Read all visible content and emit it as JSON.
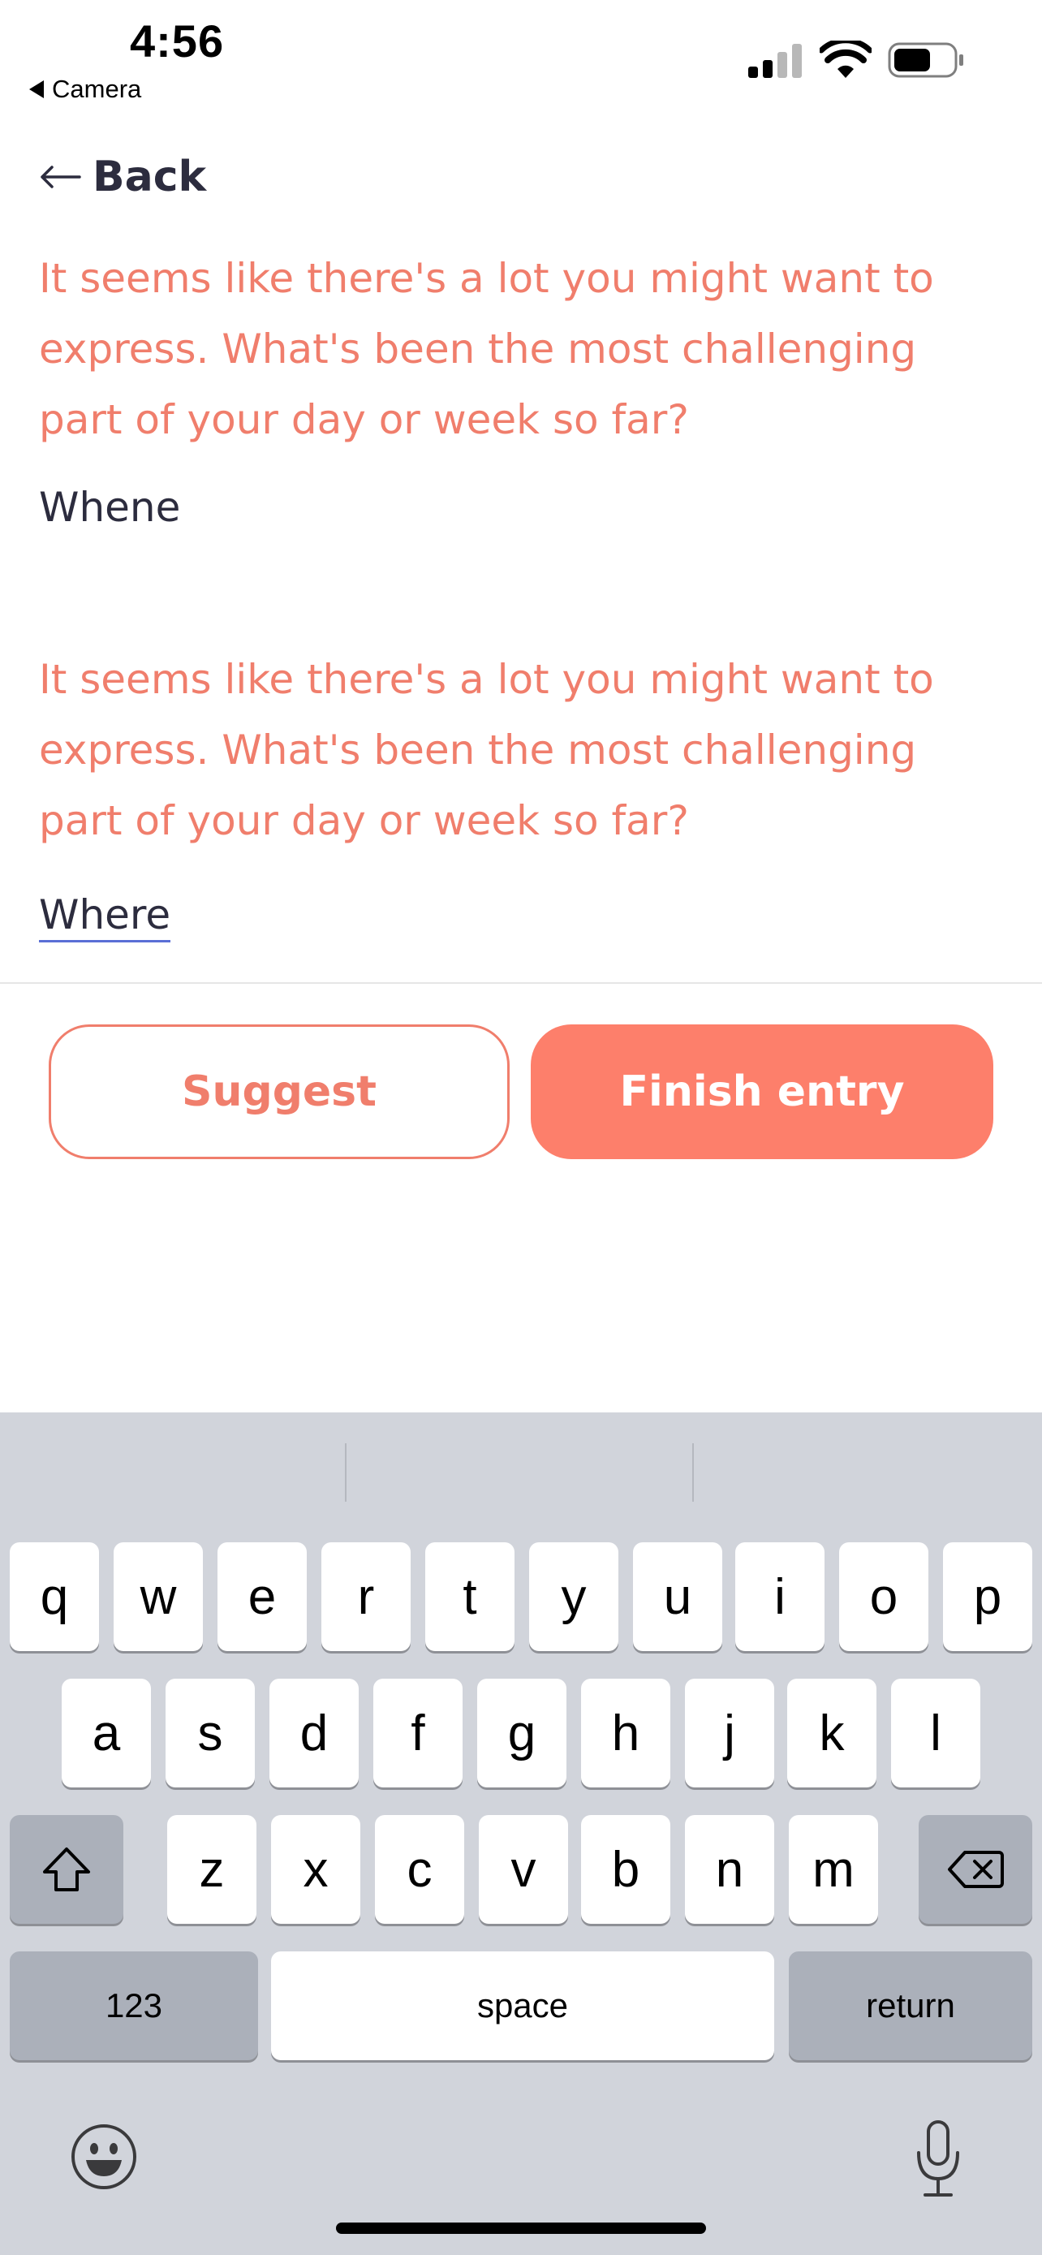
{
  "status_bar": {
    "time": "4:56",
    "back_app_label": "Camera"
  },
  "nav": {
    "back_label": "Back"
  },
  "conversation": [
    {
      "prompt": "It seems like there's a lot you might want to express. What's been the most challenging part of your day or week so far?",
      "answer": "Whene"
    },
    {
      "prompt": "It seems like there's a lot you might want to express. What's been the most challenging part of your day or week so far?",
      "answer": "Where"
    }
  ],
  "actions": {
    "suggest_label": "Suggest",
    "finish_label": "Finish entry"
  },
  "keyboard": {
    "row1": [
      "q",
      "w",
      "e",
      "r",
      "t",
      "y",
      "u",
      "i",
      "o",
      "p"
    ],
    "row2": [
      "a",
      "s",
      "d",
      "f",
      "g",
      "h",
      "j",
      "k",
      "l"
    ],
    "row3": [
      "z",
      "x",
      "c",
      "v",
      "b",
      "n",
      "m"
    ],
    "numbers_label": "123",
    "space_label": "space",
    "return_label": "return"
  },
  "colors": {
    "accent": "#fd7f6b",
    "prompt_text": "#f07e6c",
    "body_text": "#2c2c3e",
    "keyboard_bg": "#d1d4db"
  }
}
